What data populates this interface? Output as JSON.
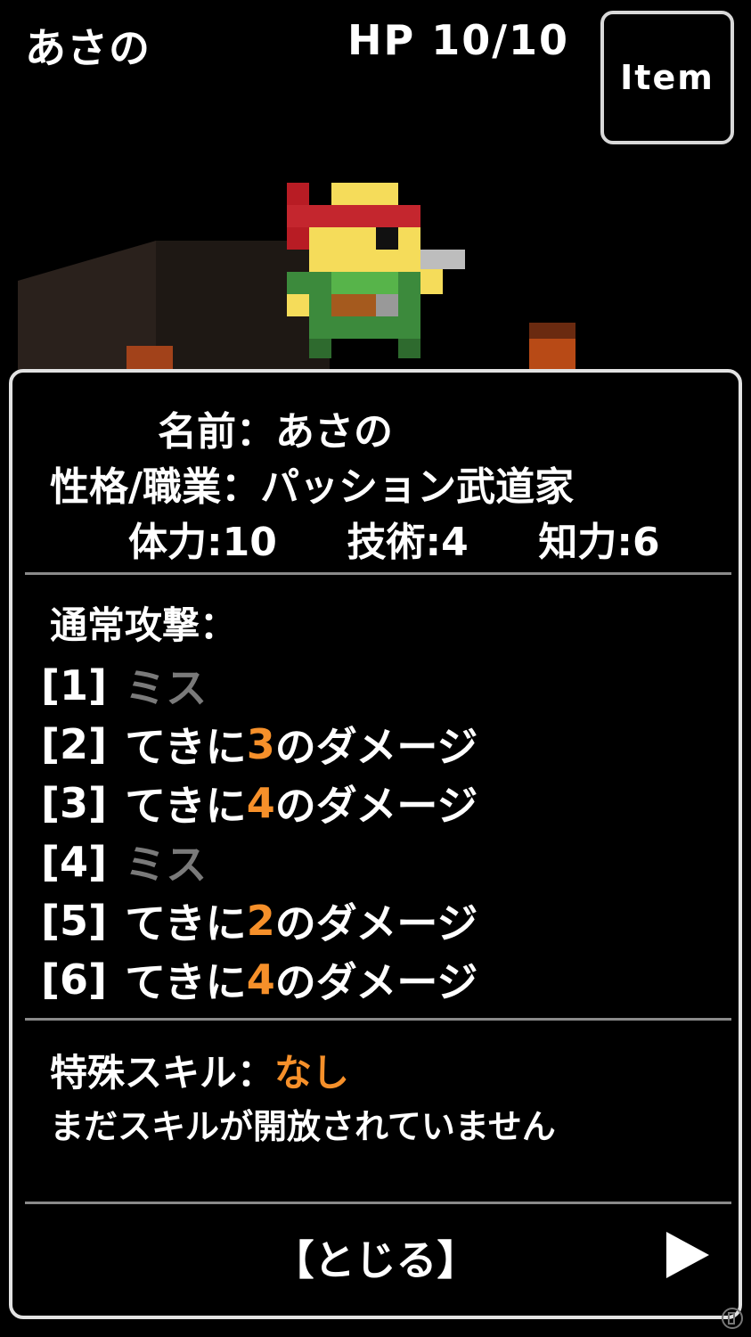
{
  "hud": {
    "player_name": "あさの",
    "hp_label": "HP",
    "hp_value": "10/10",
    "item_button": "Item"
  },
  "status": {
    "name_label": "名前：",
    "name_value": "あさの",
    "class_label": "性格/職業：",
    "class_value": "パッション武道家",
    "stats": [
      {
        "label": "体力:",
        "value": "10"
      },
      {
        "label": "技術:",
        "value": "4"
      },
      {
        "label": "知力:",
        "value": "6"
      }
    ]
  },
  "attack": {
    "title": "通常攻撃：",
    "items": [
      {
        "index": "[1]",
        "miss_text": "ミス"
      },
      {
        "index": "[2]",
        "prefix": "てきに",
        "damage": "3",
        "suffix": "のダメージ"
      },
      {
        "index": "[3]",
        "prefix": "てきに",
        "damage": "4",
        "suffix": "のダメージ"
      },
      {
        "index": "[4]",
        "miss_text": "ミス"
      },
      {
        "index": "[5]",
        "prefix": "てきに",
        "damage": "2",
        "suffix": "のダメージ"
      },
      {
        "index": "[6]",
        "prefix": "てきに",
        "damage": "4",
        "suffix": "のダメージ"
      }
    ]
  },
  "skill": {
    "label": "特殊スキル：",
    "value": "なし",
    "description": "まだスキルが開放されていません"
  },
  "footer": {
    "close_label": "【とじる】"
  },
  "colors": {
    "accent": "#f6902a",
    "miss": "#7a7a7a",
    "border": "#e2e2e2",
    "background": "#000000"
  },
  "icons": {
    "next": "play-triangle-icon",
    "watermark": "site-logo-icon"
  }
}
